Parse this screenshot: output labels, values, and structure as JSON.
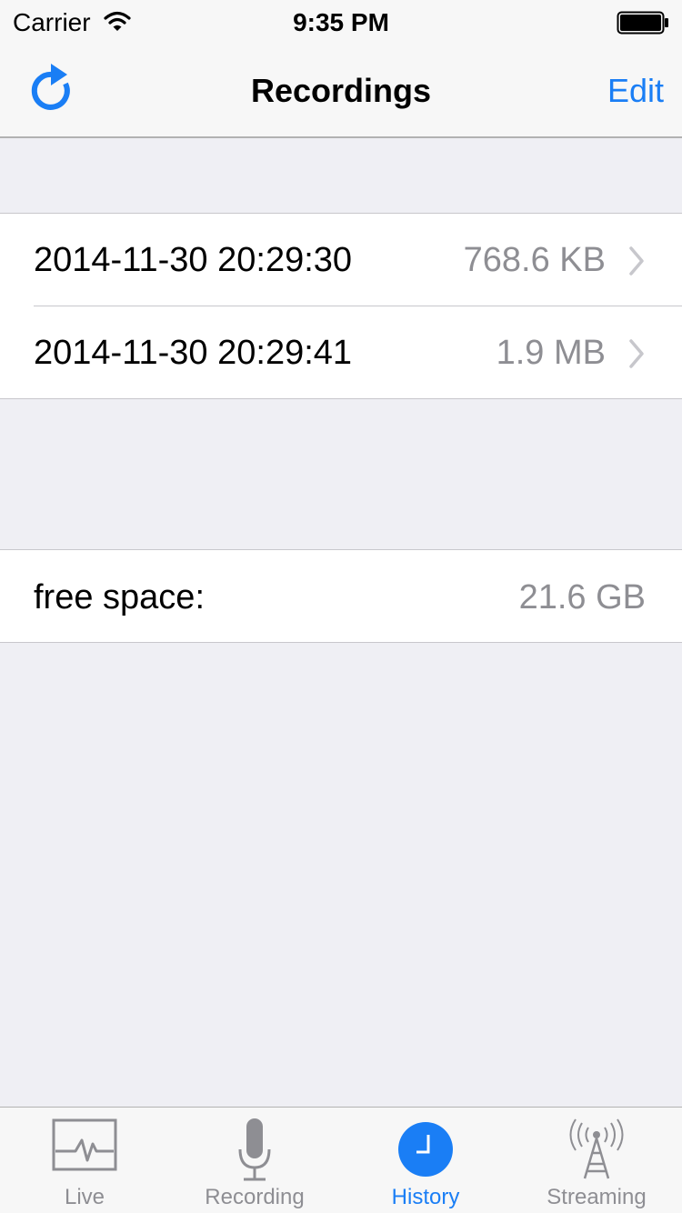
{
  "status_bar": {
    "carrier": "Carrier",
    "time": "9:35 PM"
  },
  "nav": {
    "title": "Recordings",
    "edit_label": "Edit",
    "refresh_icon": "refresh-icon"
  },
  "recordings": [
    {
      "timestamp": "2014-11-30 20:29:30",
      "size": "768.6 KB"
    },
    {
      "timestamp": "2014-11-30 20:29:41",
      "size": "1.9 MB"
    }
  ],
  "storage": {
    "label": "free space:",
    "value": "21.6 GB"
  },
  "tabs": [
    {
      "label": "Live",
      "icon": "waveform-icon",
      "active": false
    },
    {
      "label": "Recording",
      "icon": "microphone-icon",
      "active": false
    },
    {
      "label": "History",
      "icon": "clock-icon",
      "active": true
    },
    {
      "label": "Streaming",
      "icon": "antenna-tower-icon",
      "active": false
    }
  ],
  "colors": {
    "accent": "#1a7ef5",
    "background": "#efeff4",
    "secondary_text": "#8e8e93"
  }
}
